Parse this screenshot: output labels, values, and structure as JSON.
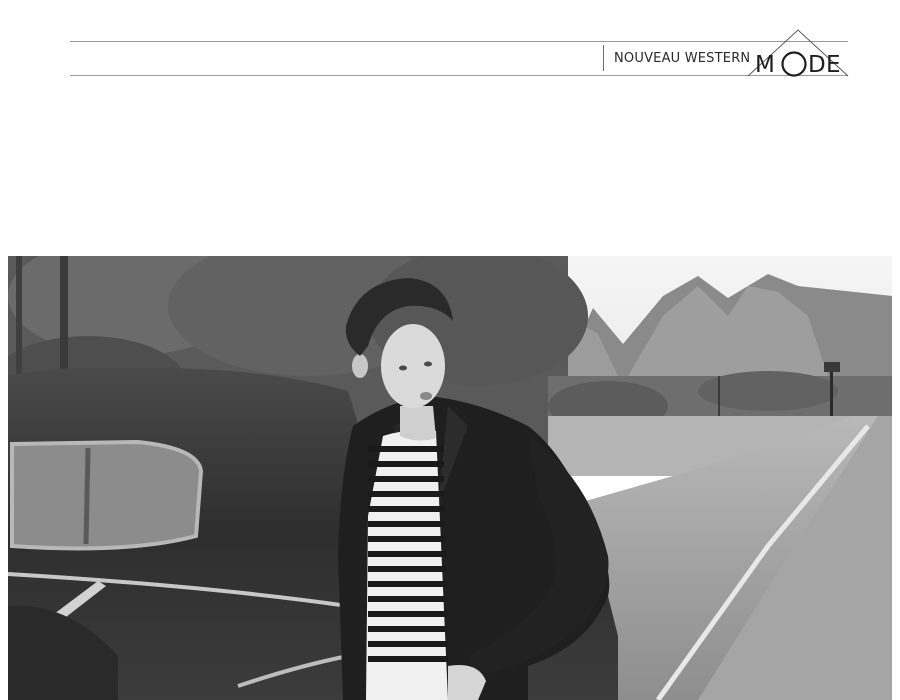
{
  "header": {
    "section_title": "NOUVEAU WESTERN",
    "logo_text": "MODE",
    "logo_letters": [
      "M",
      "D",
      "E"
    ]
  },
  "photo": {
    "subject": "man-by-vintage-car",
    "style": "black-and-white"
  },
  "colors": {
    "rule": "#9a9a9a",
    "text": "#2a2a2a",
    "background": "#ffffff"
  }
}
